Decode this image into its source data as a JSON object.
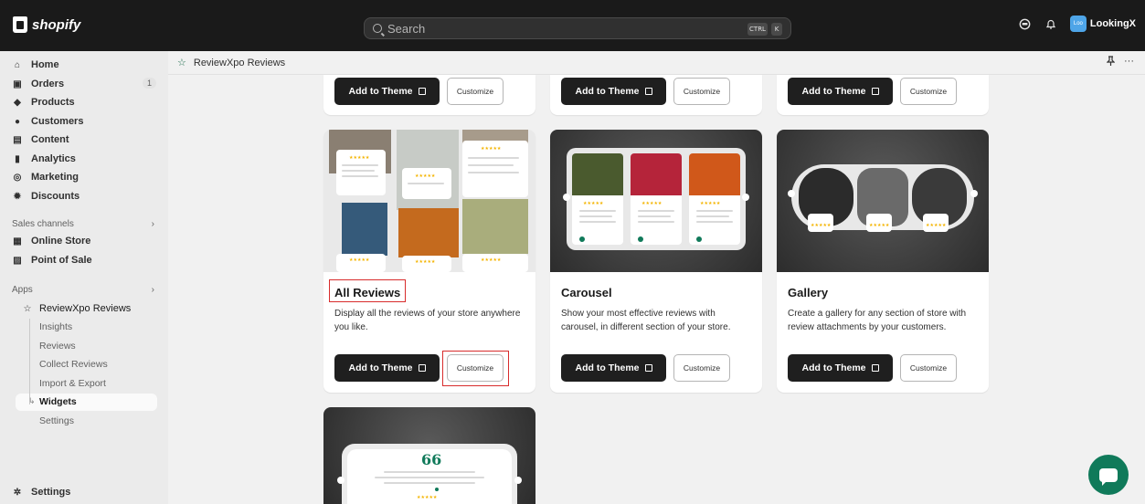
{
  "topbar": {
    "brand": "shopify",
    "search_placeholder": "Search",
    "kbd_ctrl": "CTRL",
    "kbd_k": "K",
    "store_initials": "Loo",
    "store_name": "LookingX"
  },
  "nav": {
    "home": "Home",
    "orders": "Orders",
    "orders_count": "1",
    "products": "Products",
    "customers": "Customers",
    "content": "Content",
    "analytics": "Analytics",
    "marketing": "Marketing",
    "discounts": "Discounts",
    "sales_channels": "Sales channels",
    "online_store": "Online Store",
    "point_of_sale": "Point of Sale",
    "apps": "Apps",
    "app_name": "ReviewXpo Reviews",
    "sub": [
      "Insights",
      "Reviews",
      "Collect Reviews",
      "Import & Export",
      "Widgets",
      "Settings"
    ],
    "settings": "Settings"
  },
  "header": {
    "title": "ReviewXpo Reviews",
    "more": "···"
  },
  "buttons": {
    "add": "Add to Theme",
    "customize": "Customize"
  },
  "cards": [
    {
      "title": "All Reviews",
      "desc": "Display all the reviews of your store anywhere you like."
    },
    {
      "title": "Carousel",
      "desc": "Show your most effective reviews with carousel, in different section of your store."
    },
    {
      "title": "Gallery",
      "desc": "Create a gallery for any section of store with review attachments by your customers."
    }
  ],
  "stars": "★★★★★",
  "quote": "66",
  "colors": {
    "highlight": "#d82c2c",
    "accent": "#107a5a"
  }
}
